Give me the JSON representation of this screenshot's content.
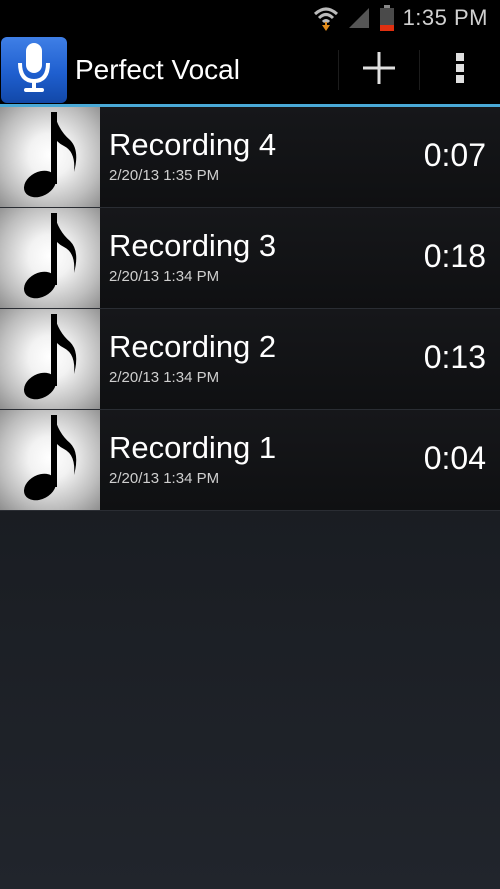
{
  "status_bar": {
    "time": "1:35 PM",
    "icons": [
      "wifi-icon",
      "signal-icon",
      "battery-icon"
    ],
    "battery_color": "#e03010"
  },
  "action_bar": {
    "title": "Perfect Vocal",
    "app_icon": "microphone-icon",
    "actions": [
      "add-icon",
      "overflow-menu-icon"
    ],
    "accent_color": "#4aa9d6"
  },
  "recordings": [
    {
      "name": "Recording 4",
      "date": "2/20/13 1:35 PM",
      "duration": "0:07",
      "icon": "music-note-icon"
    },
    {
      "name": "Recording 3",
      "date": "2/20/13 1:34 PM",
      "duration": "0:18",
      "icon": "music-note-icon"
    },
    {
      "name": "Recording 2",
      "date": "2/20/13 1:34 PM",
      "duration": "0:13",
      "icon": "music-note-icon"
    },
    {
      "name": "Recording 1",
      "date": "2/20/13 1:34 PM",
      "duration": "0:04",
      "icon": "music-note-icon"
    }
  ]
}
